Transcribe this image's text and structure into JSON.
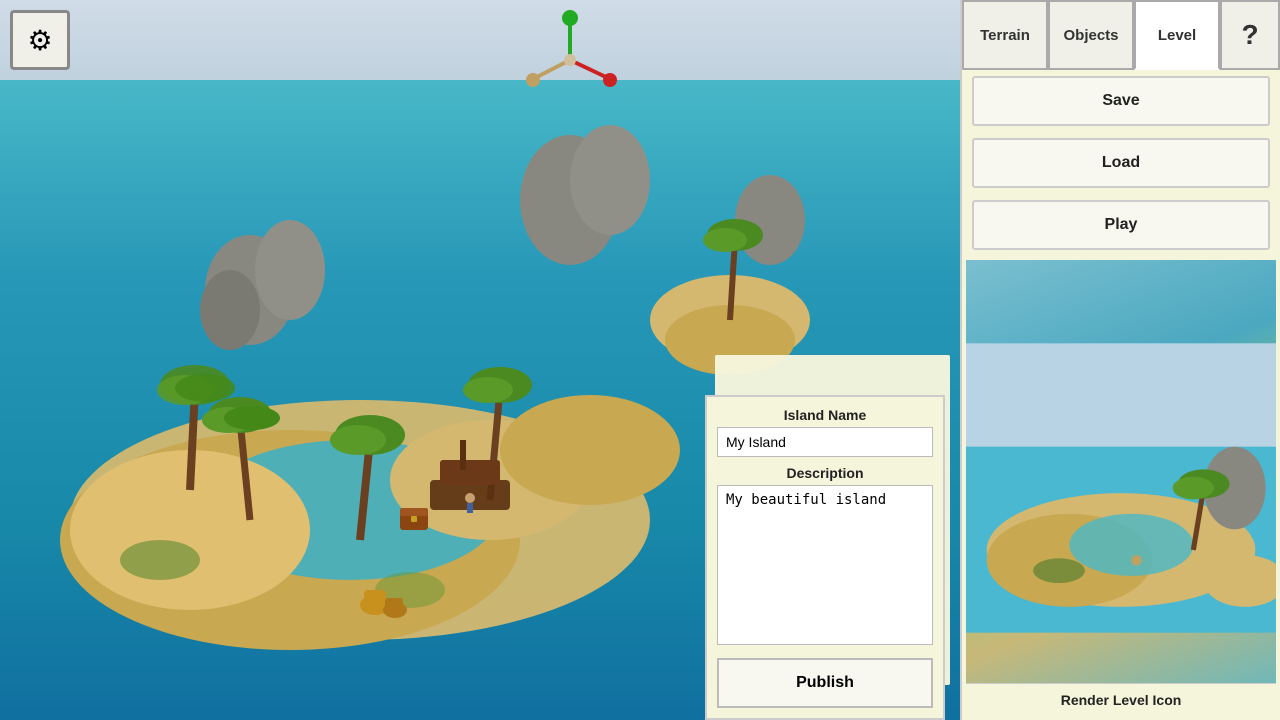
{
  "settings": {
    "gear_icon": "⚙"
  },
  "tabs": {
    "terrain": "Terrain",
    "objects": "Objects",
    "level": "Level",
    "help": "?"
  },
  "buttons": {
    "save": "Save",
    "load": "Load",
    "play": "Play",
    "publish": "Publish",
    "render_level_icon": "Render Level Icon"
  },
  "form": {
    "island_name_label": "Island Name",
    "island_name_value": "My Island",
    "description_label": "Description",
    "description_value": "My beautiful island"
  },
  "colors": {
    "panel_bg": "#f5f5dc",
    "button_bg": "#f8f8f0",
    "water": "#28a8c0",
    "sky": "#b8d0e0"
  }
}
